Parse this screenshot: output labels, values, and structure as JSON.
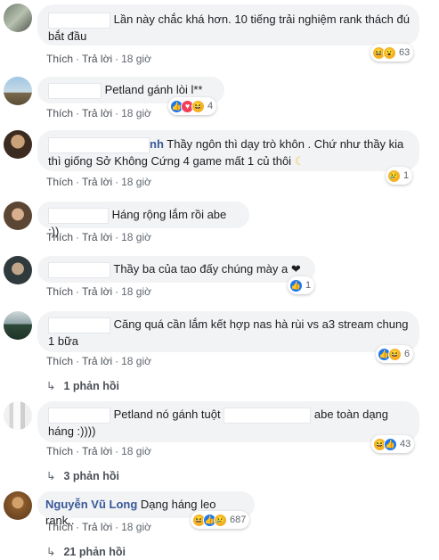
{
  "labels": {
    "like": "Thích",
    "reply": "Trả lời",
    "sep": "·"
  },
  "comments": [
    {
      "name": "",
      "text": "Lần này chắc khá hơn. 10 tiếng trải nghiệm rank thách đú bắt đầu",
      "time": "18 giờ",
      "reaction_icons": [
        "haha-icon",
        "wow-icon"
      ],
      "reaction_count": "63"
    },
    {
      "name": "",
      "text": "Petland gánh lòi l**",
      "time": "18 giờ",
      "reaction_icons": [
        "like-icon",
        "love-icon",
        "haha-icon"
      ],
      "reaction_count": "4"
    },
    {
      "name": "",
      "name_tail": "nh",
      "text": "Thầy ngôn thì dạy trò khôn . Chứ như thầy kia thì giống Sở Không Cứng 4 game mất 1 củ thôi",
      "time": "18 giờ",
      "reaction_icons": [
        "sad-icon"
      ],
      "reaction_count": "1"
    },
    {
      "name": "",
      "text": "Háng rộng lắm rồi abe :))",
      "time": "18 giờ"
    },
    {
      "name": "",
      "text": "Thầy ba của tao đấy chúng mày a ❤",
      "time": "18 giờ",
      "reaction_icons": [
        "like-icon"
      ],
      "reaction_count": "1"
    },
    {
      "name": "",
      "text": "Căng quá cần lắm kết hợp nas hà rùi vs a3 stream chung 1 bữa",
      "time": "18 giờ",
      "reaction_icons": [
        "like-icon",
        "haha-icon"
      ],
      "reaction_count": "6",
      "replies": "1 phản hồi"
    },
    {
      "name": "",
      "text_a": "Petland nó gánh tuột",
      "text_b": "abe toàn dạng háng :))))",
      "time": "18 giờ",
      "reaction_icons": [
        "haha-icon",
        "like-icon"
      ],
      "reaction_count": "43",
      "replies": "3 phản hồi"
    },
    {
      "name": "Nguyễn Vũ Long",
      "text": "Dạng háng leo rank..",
      "time": "18 giờ",
      "reaction_icons": [
        "haha-icon",
        "like-icon",
        "sad-icon"
      ],
      "reaction_count": "687",
      "replies": "21 phản hồi"
    }
  ]
}
